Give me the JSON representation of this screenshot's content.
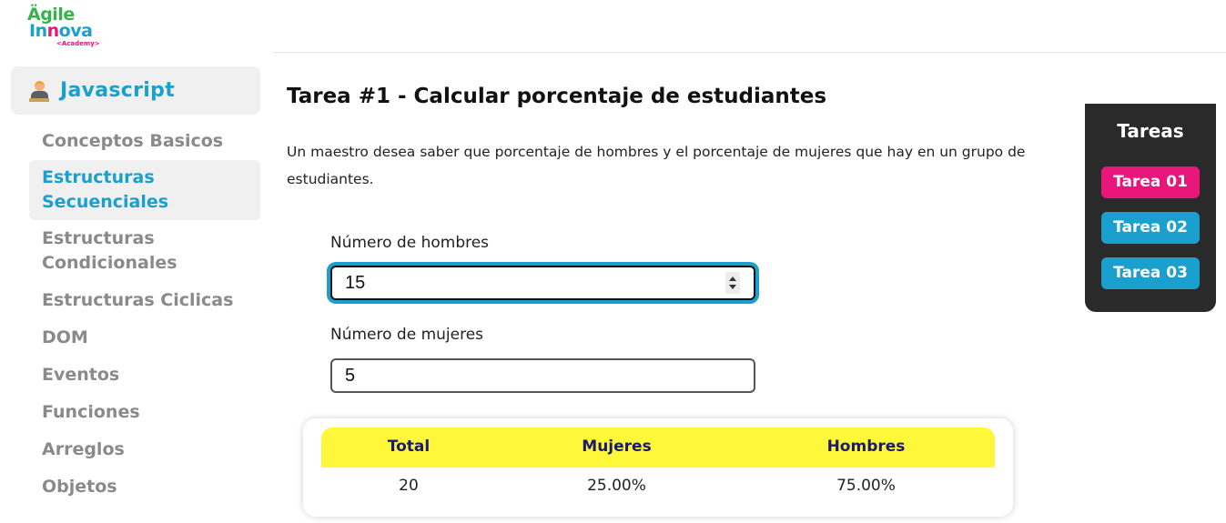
{
  "logo": {
    "line1": "Ägile",
    "line2a": "In",
    "line2b": "n",
    "line2c": "ova",
    "line3": "<Academy>"
  },
  "sidebar": {
    "header": "Javascript",
    "items": [
      {
        "label": "Conceptos Basicos"
      },
      {
        "label": "Estructuras Secuenciales"
      },
      {
        "label": "Estructuras Condicionales"
      },
      {
        "label": "Estructuras Ciclicas"
      },
      {
        "label": "DOM"
      },
      {
        "label": "Eventos"
      },
      {
        "label": "Funciones"
      },
      {
        "label": "Arreglos"
      },
      {
        "label": "Objetos"
      }
    ]
  },
  "main": {
    "title": "Tarea #1 - Calcular porcentaje de estudiantes",
    "description": "Un maestro desea saber que porcentaje de hombres y el porcentaje de mujeres que hay en un grupo de estudiantes."
  },
  "form": {
    "men_label": "Número de hombres",
    "men_value": "15",
    "women_label": "Número de mujeres",
    "women_value": "5"
  },
  "results": {
    "headers": {
      "total": "Total",
      "mujeres": "Mujeres",
      "hombres": "Hombres"
    },
    "values": {
      "total": "20",
      "mujeres": "25.00%",
      "hombres": "75.00%"
    }
  },
  "tareas": {
    "title": "Tareas",
    "buttons": [
      {
        "label": "Tarea 01"
      },
      {
        "label": "Tarea 02"
      },
      {
        "label": "Tarea 03"
      }
    ]
  },
  "colors": {
    "accent_blue": "#1aa0cf",
    "accent_pink": "#e8157a",
    "table_header": "#fff83a",
    "panel_dark": "#2a2a2a"
  }
}
